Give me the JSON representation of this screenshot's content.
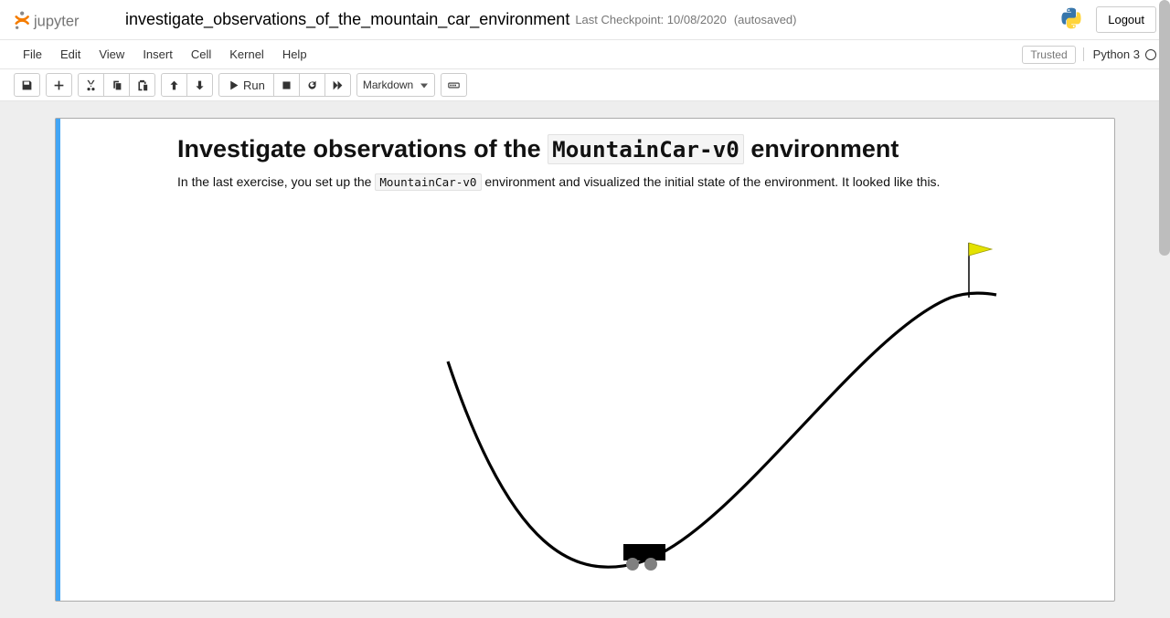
{
  "header": {
    "notebook_name": "investigate_observations_of_the_mountain_car_environment",
    "checkpoint": "Last Checkpoint: 10/08/2020",
    "autosave": "(autosaved)",
    "logout": "Logout"
  },
  "menubar": {
    "items": [
      "File",
      "Edit",
      "View",
      "Insert",
      "Cell",
      "Kernel",
      "Help"
    ],
    "trusted": "Trusted",
    "kernel": "Python 3"
  },
  "toolbar": {
    "run": "Run",
    "celltype": "Markdown"
  },
  "content": {
    "heading_pre": "Investigate observations of the ",
    "heading_code": "MountainCar-v0",
    "heading_post": " environment",
    "para_pre": "In the last exercise, you set up the ",
    "para_code": "MountainCar-v0",
    "para_post": " environment and visualized the initial state of the environment. It looked like this."
  }
}
